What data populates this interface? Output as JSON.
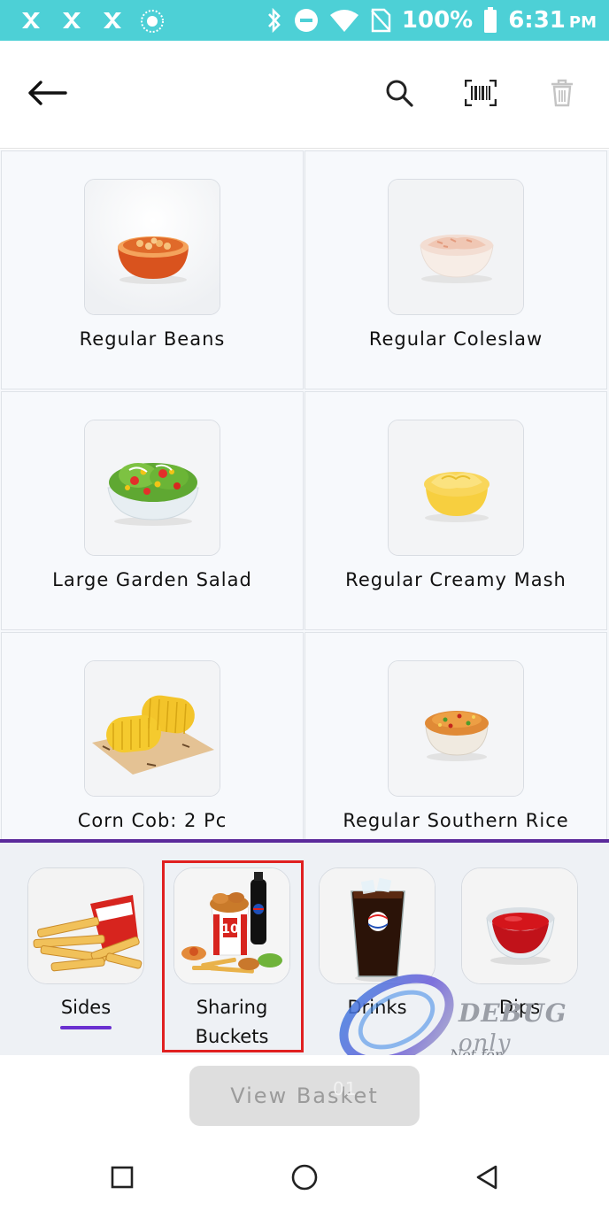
{
  "status_bar": {
    "battery": "100%",
    "time": "6:31",
    "ampm": "PM",
    "icons": [
      "app-notification-icon",
      "app-notification-icon",
      "app-notification-icon",
      "dandelion-notification-icon",
      "bluetooth-icon",
      "do-not-disturb-icon",
      "wifi-icon",
      "no-sim-icon",
      "battery-icon"
    ]
  },
  "app_bar": {
    "icons": [
      "back-arrow-icon",
      "search-icon",
      "barcode-icon",
      "trash-icon"
    ]
  },
  "products": [
    {
      "name": "Regular Beans",
      "icon": "beans-bowl-image"
    },
    {
      "name": "Regular Coleslaw",
      "icon": "coleslaw-bowl-image"
    },
    {
      "name": "Large Garden Salad",
      "icon": "salad-bowl-image"
    },
    {
      "name": "Regular Creamy Mash",
      "icon": "mash-bowl-image"
    },
    {
      "name": "Corn Cob: 2 Pc",
      "icon": "corn-cob-image"
    },
    {
      "name": "Regular Southern Rice",
      "icon": "rice-bowl-image"
    }
  ],
  "categories": [
    {
      "label": "Sides",
      "selected": true,
      "icon": "fries-image"
    },
    {
      "label": "Sharing Buckets",
      "line1": "Sharing",
      "line2": "Buckets",
      "highlighted": true,
      "icon": "bucket-image",
      "bucket_text": "10"
    },
    {
      "label": "Drinks",
      "icon": "cola-glass-image"
    },
    {
      "label": "Dips",
      "icon": "ketchup-dip-image"
    }
  ],
  "watermark": {
    "line1": "DEBUG",
    "line1_suffix": "only",
    "line2": "Not for COMMERCIAL"
  },
  "basket": {
    "label": "View Basket",
    "count": "01"
  },
  "nav_bar": {
    "icons": [
      "recents-square-icon",
      "home-circle-icon",
      "back-triangle-icon"
    ]
  },
  "colors": {
    "status_bar": "#4dd0d6",
    "accent_purple": "#5b2a9b",
    "selected_underline": "#6a2fd0",
    "highlight_red": "#e02020",
    "basket_button": "#dedede"
  }
}
